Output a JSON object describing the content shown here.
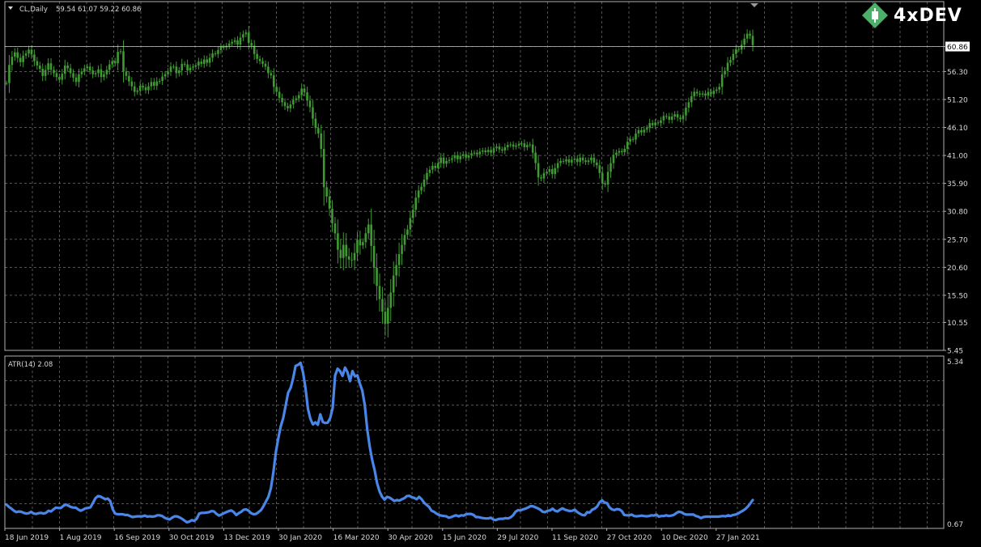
{
  "header": {
    "symbol": "CL,Daily",
    "ohlc": "59.54 61.07 59.22 60.86",
    "indicator": "ATR(14) 2.08"
  },
  "logo": {
    "text": "4xDEV"
  },
  "colors": {
    "background": "#000000",
    "grid": "#8a8a8a",
    "candle": "#3f9a32",
    "atr": "#4a86e8",
    "text": "#d8d8d8",
    "price_marker_bg": "#ffffff",
    "logo_green": "#4cb06a"
  },
  "chart_data": [
    {
      "type": "candlestick",
      "title": "CL,Daily",
      "ylim": [
        5.45,
        65.0
      ],
      "yticks": [
        "60.86",
        "56.30",
        "51.20",
        "46.10",
        "41.00",
        "35.90",
        "30.80",
        "25.70",
        "20.60",
        "15.50",
        "10.55",
        "5.45"
      ],
      "last_price": "60.86",
      "xticks": [
        "18 Jun 2019",
        "1 Aug 2019",
        "16 Sep 2019",
        "30 Oct 2019",
        "13 Dec 2019",
        "30 Jan 2020",
        "16 Mar 2020",
        "30 Apr 2020",
        "15 Jun 2020",
        "29 Jul 2020",
        "11 Sep 2020",
        "27 Oct 2020",
        "10 Dec 2020",
        "27 Jan 2021"
      ],
      "series": [
        {
          "close": [
            54.2,
            57.5,
            59.0,
            59.8,
            58.8,
            58.0,
            59.2,
            59.6,
            60.3,
            59.4,
            58.2,
            57.4,
            56.8,
            55.5,
            56.6,
            57.8,
            56.6,
            56.0,
            55.3,
            54.8,
            55.9,
            57.4,
            56.9,
            56.0,
            55.2,
            54.4,
            55.8,
            56.3,
            56.9,
            57.2,
            56.5,
            55.8,
            56.0,
            56.7,
            55.3,
            55.8,
            56.6,
            57.6,
            58.2,
            57.8,
            59.9,
            60.0,
            56.3,
            55.5,
            54.5,
            53.6,
            52.6,
            52.8,
            53.7,
            53.4,
            52.9,
            53.6,
            54.4,
            53.7,
            54.5,
            54.6,
            55.4,
            55.8,
            56.3,
            57.2,
            57.2,
            56.0,
            56.5,
            57.7,
            57.6,
            56.5,
            57.0,
            57.2,
            57.4,
            58.1,
            57.7,
            58.5,
            57.9,
            58.8,
            59.6,
            59.5,
            60.2,
            60.8,
            60.7,
            61.0,
            61.4,
            61.7,
            62.0,
            61.2,
            62.5,
            63.1,
            63.4,
            61.5,
            61.0,
            59.5,
            58.6,
            58.2,
            57.7,
            57.2,
            56.0,
            55.6,
            53.5,
            52.6,
            51.5,
            50.7,
            50.0,
            49.6,
            50.3,
            51.1,
            51.4,
            52.0,
            53.2,
            52.5,
            51.0,
            49.8,
            47.7,
            46.0,
            45.0,
            42.2,
            35.2,
            33.5,
            31.3,
            28.6,
            26.8,
            23.8,
            22.3,
            24.7,
            22.6,
            22.0,
            21.9,
            23.2,
            25.6,
            24.6,
            25.2,
            26.8,
            28.4,
            24.5,
            20.5,
            17.2,
            14.8,
            12.5,
            10.3,
            13.2,
            16.0,
            19.1,
            21.0,
            23.0,
            24.7,
            26.5,
            27.5,
            29.6,
            31.1,
            33.3,
            34.6,
            35.3,
            36.6,
            37.8,
            38.4,
            39.1,
            38.7,
            39.6,
            40.6,
            39.5,
            40.0,
            40.2,
            40.5,
            41.0,
            40.3,
            40.9,
            41.2,
            40.6,
            41.0,
            41.4,
            41.5,
            41.2,
            41.7,
            41.9,
            41.6,
            42.0,
            41.5,
            42.3,
            42.6,
            42.1,
            41.9,
            42.5,
            42.9,
            43.0,
            42.6,
            42.8,
            43.1,
            43.2,
            42.5,
            42.9,
            43.0,
            41.5,
            39.6,
            37.0,
            36.8,
            37.8,
            38.0,
            38.5,
            37.6,
            38.7,
            39.6,
            40.0,
            39.9,
            40.3,
            39.7,
            40.2,
            40.4,
            39.8,
            40.6,
            40.1,
            39.8,
            40.1,
            40.6,
            39.7,
            39.2,
            37.8,
            35.9,
            35.7,
            38.0,
            39.6,
            41.1,
            41.5,
            41.8,
            41.6,
            42.2,
            43.5,
            44.0,
            43.9,
            45.0,
            45.6,
            45.2,
            45.7,
            46.0,
            46.9,
            46.5,
            47.0,
            46.9,
            47.4,
            48.2,
            48.1,
            47.5,
            48.1,
            48.5,
            47.9,
            47.6,
            48.3,
            49.7,
            50.7,
            51.8,
            52.6,
            52.3,
            52.1,
            52.3,
            51.9,
            52.6,
            52.2,
            52.8,
            53.0,
            53.5,
            55.8,
            56.4,
            57.9,
            58.4,
            59.5,
            60.4,
            60.3,
            61.2,
            62.3,
            63.2,
            62.8,
            61.1
          ]
        }
      ]
    },
    {
      "type": "line",
      "title": "ATR(14) 2.08",
      "ylim": [
        0.67,
        5.34
      ],
      "yticks": [
        "5.34",
        "0.67"
      ],
      "series": [
        {
          "name": "ATR(14)",
          "values": [
            1.24,
            1.17,
            1.12,
            1.06,
            1.02,
            1.04,
            1.03,
            1.0,
            0.98,
            0.99,
            1.03,
            0.98,
            0.97,
            0.99,
            1.0,
            0.98,
            1.0,
            1.06,
            1.04,
            1.1,
            1.15,
            1.14,
            1.14,
            1.2,
            1.24,
            1.21,
            1.17,
            1.15,
            1.15,
            1.1,
            1.06,
            1.09,
            1.13,
            1.14,
            1.16,
            1.29,
            1.42,
            1.48,
            1.47,
            1.43,
            1.39,
            1.41,
            1.34,
            1.1,
            0.98,
            0.96,
            0.96,
            0.96,
            0.94,
            0.94,
            0.91,
            0.88,
            0.89,
            0.9,
            0.9,
            0.9,
            0.92,
            0.89,
            0.9,
            0.89,
            0.9,
            0.93,
            0.93,
            0.91,
            0.86,
            0.83,
            0.81,
            0.86,
            0.9,
            0.9,
            0.87,
            0.83,
            0.78,
            0.73,
            0.75,
            0.79,
            0.77,
            0.83,
            0.98,
            1.0,
            1.0,
            1.01,
            1.02,
            1.05,
            1.04,
            0.97,
            0.92,
            0.95,
            0.99,
            1.02,
            1.05,
            1.07,
            1.02,
            0.94,
            0.99,
            1.03,
            1.09,
            1.1,
            1.06,
            0.99,
            0.96,
            0.97,
            1.02,
            1.08,
            1.19,
            1.33,
            1.46,
            1.71,
            2.16,
            2.74,
            3.14,
            3.49,
            3.72,
            4.09,
            4.45,
            4.59,
            4.86,
            5.22,
            5.25,
            5.31,
            5.03,
            4.59,
            3.98,
            3.7,
            3.54,
            3.6,
            3.53,
            3.83,
            3.61,
            3.58,
            3.59,
            3.72,
            4.01,
            4.94,
            5.14,
            5.07,
            4.93,
            5.17,
            5.04,
            4.78,
            5.07,
            4.92,
            4.95,
            4.71,
            4.51,
            4.09,
            3.4,
            2.9,
            2.52,
            2.22,
            1.85,
            1.61,
            1.46,
            1.38,
            1.46,
            1.44,
            1.39,
            1.34,
            1.37,
            1.35,
            1.39,
            1.42,
            1.48,
            1.49,
            1.45,
            1.43,
            1.39,
            1.46,
            1.39,
            1.29,
            1.23,
            1.17,
            1.06,
            1.03,
            0.98,
            0.94,
            0.92,
            0.91,
            0.9,
            0.86,
            0.88,
            0.91,
            0.93,
            0.9,
            0.93,
            0.92,
            0.96,
            0.97,
            0.97,
            0.94,
            0.88,
            0.88,
            0.86,
            0.85,
            0.84,
            0.84,
            0.86,
            0.81,
            0.79,
            0.82,
            0.83,
            0.83,
            0.85,
            0.84,
            0.87,
            0.93,
            1.03,
            1.08,
            1.07,
            1.1,
            1.12,
            1.15,
            1.19,
            1.19,
            1.16,
            1.13,
            1.09,
            1.03,
            1.02,
            1.06,
            1.07,
            1.12,
            1.06,
            1.04,
            1.09,
            1.13,
            1.09,
            1.07,
            1.05,
            1.06,
            1.09,
            1.02,
            0.98,
            0.94,
            0.93,
            1.02,
            1.01,
            1.09,
            1.12,
            1.18,
            1.3,
            1.36,
            1.3,
            1.28,
            1.16,
            1.1,
            1.08,
            1.11,
            1.1,
            1.05,
            0.94,
            0.93,
            0.93,
            0.95,
            0.91,
            0.9,
            0.91,
            0.92,
            0.91,
            0.9,
            0.91,
            0.93,
            0.92,
            0.95,
            0.89,
            0.91,
            0.91,
            0.93,
            0.91,
            0.92,
            0.94,
            0.99,
            1.03,
            1.02,
            0.98,
            0.95,
            0.95,
            0.95,
            0.95,
            0.91,
            0.89,
            0.85,
            0.88,
            0.89,
            0.89,
            0.89,
            0.89,
            0.89,
            0.89,
            0.9,
            0.91,
            0.9,
            0.93,
            0.91,
            0.94,
            0.95,
            0.98,
            1.02,
            1.06,
            1.11,
            1.18,
            1.27,
            1.37
          ]
        }
      ]
    }
  ]
}
